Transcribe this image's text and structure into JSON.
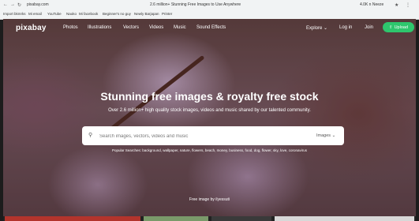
{
  "browser": {
    "url": "pixabay.com",
    "tab_title": "2.6 million+ Stunning Free Images to Use Anywhere",
    "bookmarks": [
      "Import bkmrks",
      "Mi email",
      "YouTube",
      "Naoko",
      "Mi facebook",
      "Beginner's no guy",
      "Newly Barjapan",
      "Printer"
    ],
    "right_label": "4.0K n Neeze"
  },
  "header": {
    "logo": "pixabay",
    "menu": [
      "Photos",
      "Illustrations",
      "Vectors",
      "Videos",
      "Music",
      "Sound Effects"
    ],
    "explore": "Explore",
    "login": "Log in",
    "join": "Join",
    "upload": "Upload"
  },
  "hero": {
    "title": "Stunning free images & royalty free stock",
    "subtitle": "Over 2.6 million+ high quality stock images, videos and music shared by our talented community.",
    "search_placeholder": "Search images, vectors, videos and music",
    "search_type": "Images",
    "popular": "Popular Searches: background, wallpaper, nature, flowers, beach, money, business, food, dog, flower, sky, love, coronavirus",
    "credit": "Free image by ilyessuti"
  },
  "colors": {
    "accent": "#2ec66d"
  }
}
